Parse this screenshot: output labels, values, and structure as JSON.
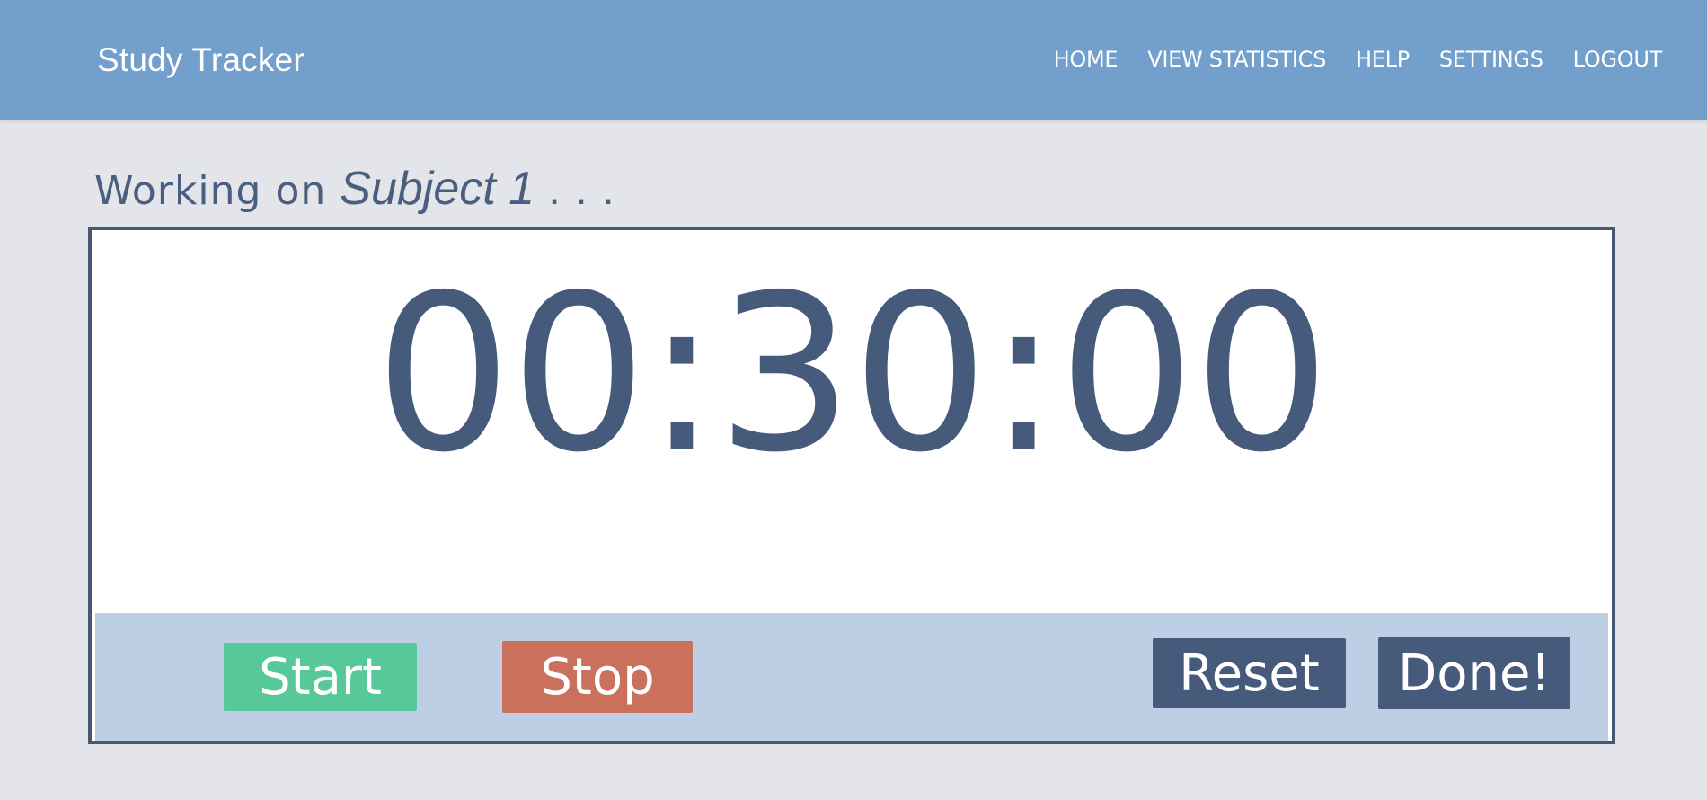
{
  "navbar": {
    "brand": "Study Tracker",
    "links": [
      "HOME",
      "VIEW STATISTICS",
      "HELP",
      "SETTINGS",
      "LOGOUT"
    ],
    "background_color": "#729fcc"
  },
  "status": {
    "prefix": "Working on",
    "subject": "Subject 1",
    "suffix": ". . ."
  },
  "timer": {
    "display": "00:30:00"
  },
  "controls": {
    "start_label": "Start",
    "stop_label": "Stop",
    "reset_label": "Reset",
    "done_label": "Done!",
    "colors": {
      "start": "#57c898",
      "stop": "#cb705c",
      "reset": "#465a7c",
      "done": "#465a7c",
      "bar": "#bccfe4"
    }
  }
}
